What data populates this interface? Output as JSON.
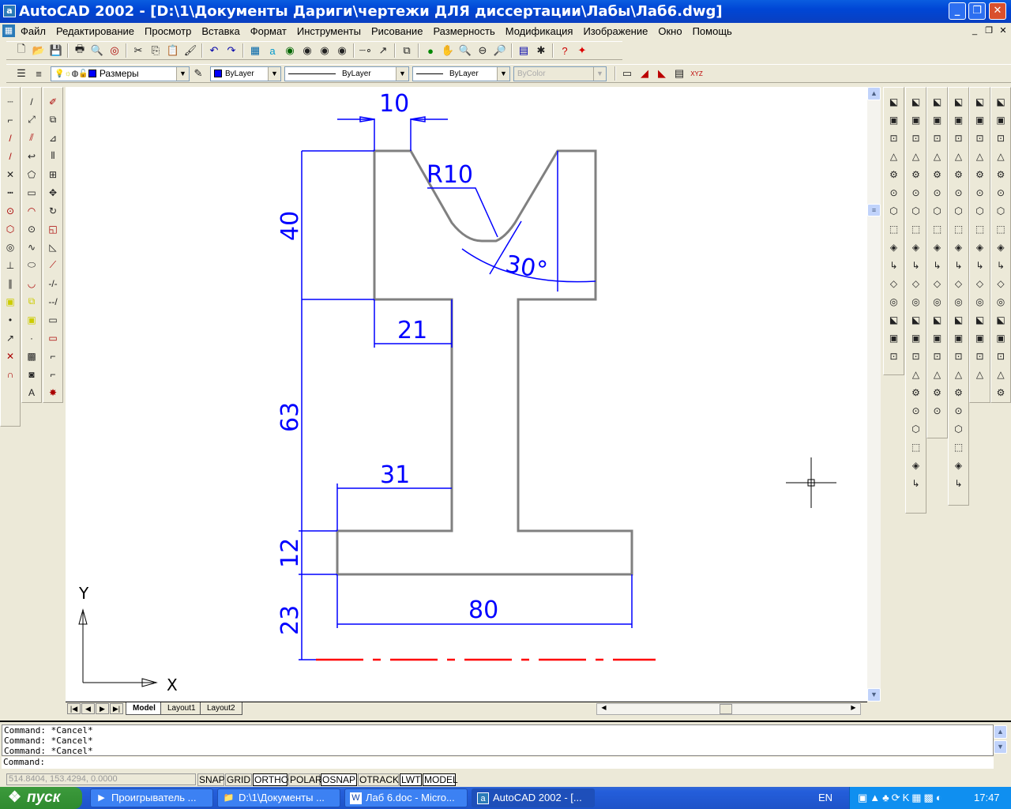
{
  "window": {
    "title": "AutoCAD 2002 - [D:\\1\\Документы Дариги\\чертежи ДЛЯ диссертации\\Лабы\\Лаб6.dwg]",
    "minimize": "_",
    "maximize": "❐",
    "close": "✕"
  },
  "menu": {
    "items": [
      "Файл",
      "Редактирование",
      "Просмотр",
      "Вставка",
      "Формат",
      "Инструменты",
      "Рисование",
      "Размерность",
      "Модификация",
      "Изображение",
      "Окно",
      "Помощь"
    ]
  },
  "toolbar_properties": {
    "layer": "Размеры",
    "color": "ByLayer",
    "linetype": "ByLayer",
    "lineweight": "ByLayer",
    "plotstyle": "ByColor"
  },
  "drawing": {
    "dims": {
      "d10": "10",
      "r10": "R10",
      "a30": "30°",
      "d40": "40",
      "d21": "21",
      "d63": "63",
      "d31": "31",
      "d12": "12",
      "d80": "80",
      "d23": "23"
    },
    "ucs": {
      "x": "X",
      "y": "Y"
    },
    "colors": {
      "outline": "#808080",
      "dimension": "#0000ff",
      "centerline": "#ff0000"
    }
  },
  "tabs": {
    "items": [
      "Model",
      "Layout1",
      "Layout2"
    ],
    "active": "Model"
  },
  "command": {
    "history": [
      "Command:  *Cancel*",
      "Command:  *Cancel*",
      "Command:  *Cancel*"
    ],
    "prompt": "Command:"
  },
  "status": {
    "coords": "514.8404, 153.4294, 0.0000",
    "toggles": [
      {
        "label": "SNAP",
        "on": false
      },
      {
        "label": "GRID",
        "on": false
      },
      {
        "label": "ORTHO",
        "on": true
      },
      {
        "label": "POLAR",
        "on": false
      },
      {
        "label": "OSNAP",
        "on": true
      },
      {
        "label": "OTRACK",
        "on": false
      },
      {
        "label": "LWT",
        "on": true
      },
      {
        "label": "MODEL",
        "on": true
      }
    ]
  },
  "taskbar": {
    "start": "пуск",
    "tasks": [
      "Проигрыватель ...",
      "D:\\1\\Документы ...",
      "Лаб 6.doc - Micro...",
      "AutoCAD 2002 - [..."
    ],
    "lang": "EN",
    "clock": "17:47"
  }
}
